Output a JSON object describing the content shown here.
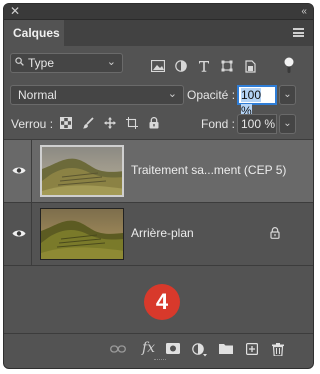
{
  "panel": {
    "title_close": "✕",
    "title_collapse": "‹‹",
    "tab_label": "Calques"
  },
  "filter": {
    "type_label": "Type",
    "icons": [
      "image-filter-icon",
      "adjustment-filter-icon",
      "text-filter-icon",
      "shape-filter-icon",
      "smartobject-filter-icon",
      "filter-toggle-icon"
    ]
  },
  "blend": {
    "mode": "Normal",
    "opacity_label": "Opacité :",
    "opacity_value": "100 %"
  },
  "lock": {
    "label": "Verrou :",
    "icons": [
      "lock-transparent-icon",
      "lock-image-icon",
      "lock-position-icon",
      "lock-artboard-icon",
      "lock-all-icon"
    ],
    "fill_label": "Fond :",
    "fill_value": "100 %"
  },
  "layers": [
    {
      "name": "Traitement sa...ment (CEP 5)",
      "selected": true,
      "visible": true,
      "locked": false
    },
    {
      "name": "Arrière-plan",
      "selected": false,
      "visible": true,
      "locked": true
    }
  ],
  "badge": "4",
  "bottom_toolbar": {
    "fx_label": "fx"
  },
  "colors": {
    "panel_bg": "#535353",
    "selected_row": "#696969",
    "accent": "#2f7dd6",
    "badge": "#d8392b"
  }
}
